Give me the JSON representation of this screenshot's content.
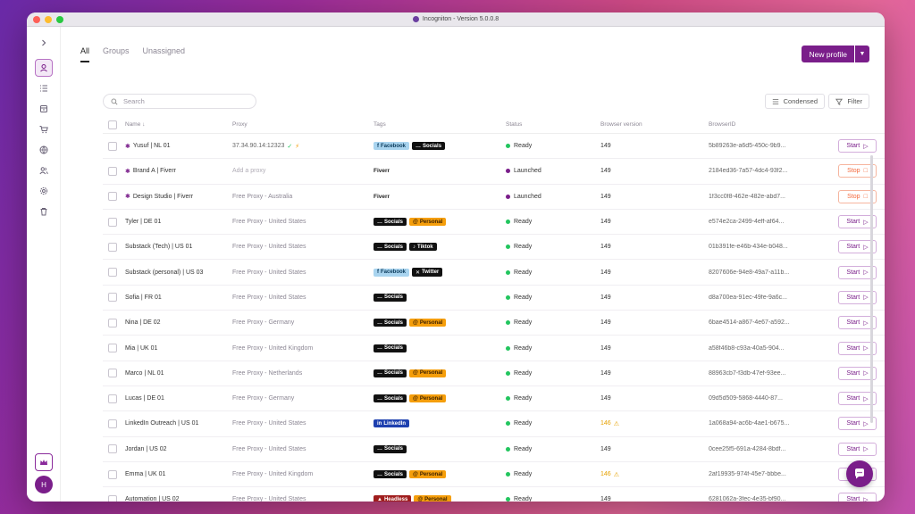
{
  "window": {
    "title": "Incogniton - Version 5.0.0.8"
  },
  "avatar_initial": "H",
  "tabs": [
    {
      "label": "All",
      "active": true
    },
    {
      "label": "Groups",
      "active": false
    },
    {
      "label": "Unassigned",
      "active": false
    }
  ],
  "actions": {
    "new_profile": "New profile",
    "condensed": "Condensed",
    "filter": "Filter"
  },
  "search": {
    "placeholder": "Search"
  },
  "columns": {
    "name": "Name ↓",
    "proxy": "Proxy",
    "tags": "Tags",
    "status": "Status",
    "browser_version": "Browser version",
    "browser_id": "BrowserID"
  },
  "tag_colors": {
    "Facebook": "#a9d4ef",
    "Socials": "#111111",
    "Personal": "#f59e0b",
    "Tiktok": "#111111",
    "Twitter": "#111111",
    "LinkedIn": "#1e40af",
    "Headless": "#9f1d1d"
  },
  "status_colors": {
    "Ready": "#22c55e",
    "Launched": "#7a1e8a"
  },
  "rows": [
    {
      "name": "Yusuf | NL 01",
      "pinned": true,
      "proxy": "37.34.90.14:12323",
      "proxy_type": "ip",
      "tags": [
        "Facebook",
        "Socials"
      ],
      "status": "Ready",
      "version": "149",
      "version_warn": false,
      "id": "5b89263e-a6d5-450c-9b9...",
      "action": "Start"
    },
    {
      "name": "Brand A | Fiverr",
      "pinned": true,
      "proxy": "Add a proxy",
      "proxy_type": "add",
      "tags": [
        "Fiverr"
      ],
      "status": "Launched",
      "version": "149",
      "version_warn": false,
      "id": "2184ed36-7a57-4dc4-93f2...",
      "action": "Stop"
    },
    {
      "name": "Design Studio | Fiverr",
      "pinned": true,
      "proxy": "Free Proxy - Australia",
      "proxy_type": "free",
      "tags": [
        "Fiverr"
      ],
      "status": "Launched",
      "version": "149",
      "version_warn": false,
      "id": "1f3cc0f8-462e-482e-abd7...",
      "action": "Stop"
    },
    {
      "name": "Tyler | DE 01",
      "pinned": false,
      "proxy": "Free Proxy - United States",
      "proxy_type": "free",
      "tags": [
        "Socials",
        "Personal"
      ],
      "status": "Ready",
      "version": "149",
      "version_warn": false,
      "id": "e574e2ca-2499-4eff-af64...",
      "action": "Start"
    },
    {
      "name": "Substack (Tech) | US 01",
      "pinned": false,
      "proxy": "Free Proxy - United States",
      "proxy_type": "free",
      "tags": [
        "Socials",
        "Tiktok"
      ],
      "status": "Ready",
      "version": "149",
      "version_warn": false,
      "id": "01b391fe-e46b-434e-b048...",
      "action": "Start"
    },
    {
      "name": "Substack (personal) | US 03",
      "pinned": false,
      "proxy": "Free Proxy - United States",
      "proxy_type": "free",
      "tags": [
        "Facebook",
        "Twitter"
      ],
      "status": "Ready",
      "version": "149",
      "version_warn": false,
      "id": "8207606e-94e8-49a7-a11b...",
      "action": "Start"
    },
    {
      "name": "Sofia | FR 01",
      "pinned": false,
      "proxy": "Free Proxy - United States",
      "proxy_type": "free",
      "tags": [
        "Socials"
      ],
      "status": "Ready",
      "version": "149",
      "version_warn": false,
      "id": "d8a700ea-91ec-49fe-9a6c...",
      "action": "Start"
    },
    {
      "name": "Nina | DE 02",
      "pinned": false,
      "proxy": "Free Proxy - Germany",
      "proxy_type": "free",
      "tags": [
        "Socials",
        "Personal"
      ],
      "status": "Ready",
      "version": "149",
      "version_warn": false,
      "id": "6bae4514-a867-4e67-a592...",
      "action": "Start"
    },
    {
      "name": "Mia | UK 01",
      "pinned": false,
      "proxy": "Free Proxy - United Kingdom",
      "proxy_type": "free",
      "tags": [
        "Socials"
      ],
      "status": "Ready",
      "version": "149",
      "version_warn": false,
      "id": "a58f46b8-c93a-40a5-904...",
      "action": "Start"
    },
    {
      "name": "Marco | NL 01",
      "pinned": false,
      "proxy": "Free Proxy - Netherlands",
      "proxy_type": "free",
      "tags": [
        "Socials",
        "Personal"
      ],
      "status": "Ready",
      "version": "149",
      "version_warn": false,
      "id": "88963cb7-f3db-47ef-93ee...",
      "action": "Start"
    },
    {
      "name": "Lucas | DE 01",
      "pinned": false,
      "proxy": "Free Proxy - Germany",
      "proxy_type": "free",
      "tags": [
        "Socials",
        "Personal"
      ],
      "status": "Ready",
      "version": "149",
      "version_warn": false,
      "id": "09d5d509-5868-4440-87...",
      "action": "Start"
    },
    {
      "name": "LinkedIn Outreach | US 01",
      "pinned": false,
      "proxy": "Free Proxy - United States",
      "proxy_type": "free",
      "tags": [
        "LinkedIn"
      ],
      "status": "Ready",
      "version": "146",
      "version_warn": true,
      "id": "1a068a94-ac6b-4ae1-b675...",
      "action": "Start"
    },
    {
      "name": "Jordan | US 02",
      "pinned": false,
      "proxy": "Free Proxy - United States",
      "proxy_type": "free",
      "tags": [
        "Socials"
      ],
      "status": "Ready",
      "version": "149",
      "version_warn": false,
      "id": "0cee25f5-691a-4284-8bdf...",
      "action": "Start"
    },
    {
      "name": "Emma | UK 01",
      "pinned": false,
      "proxy": "Free Proxy - United Kingdom",
      "proxy_type": "free",
      "tags": [
        "Socials",
        "Personal"
      ],
      "status": "Ready",
      "version": "146",
      "version_warn": true,
      "id": "2af19935-974f-45e7-bbbe...",
      "action": "Start"
    },
    {
      "name": "Automation | US 02",
      "pinned": false,
      "proxy": "Free Proxy - United States",
      "proxy_type": "free",
      "tags": [
        "Headless",
        "Personal"
      ],
      "status": "Ready",
      "version": "149",
      "version_warn": false,
      "id": "6281062a-3fec-4e35-bf90...",
      "action": "Start"
    }
  ]
}
